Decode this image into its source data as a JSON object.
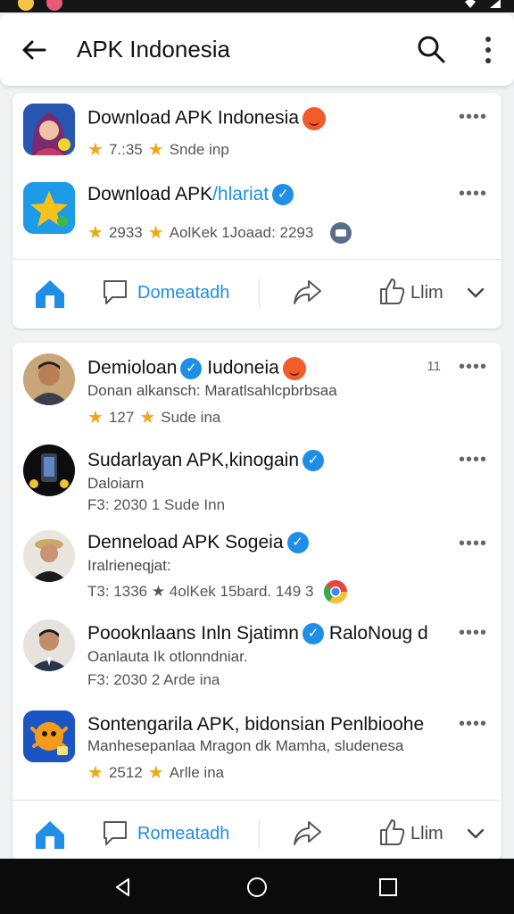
{
  "app_bar": {
    "title": "APK Indonesia"
  },
  "card1": {
    "items": [
      {
        "name": "Download APK Indonesia",
        "meta": "7.:35 ★ Snde inp",
        "rating": "7.:35",
        "meta_tail": "Snde inp",
        "badge": "emoji-red",
        "colors": [
          "#2b57b8",
          "#f0b7a0"
        ]
      },
      {
        "name": "Download APK",
        "name_accent": "/hlariat",
        "rating": "2933",
        "meta_tail": "AolKek  1Joaad: 2293",
        "badge": "verify",
        "colors": [
          "#1e9be6",
          "#f7c11b"
        ]
      }
    ],
    "actions": {
      "label": "Domeatadh",
      "like_label": "Llim"
    }
  },
  "card2": {
    "items": [
      {
        "name": "Demioloan",
        "name_after": "Iudoneia",
        "sub": "Donan alkansch: Maratlsahlcpbrbsaa",
        "rating": "127",
        "meta_tail": "Sude ina",
        "time": "11",
        "badge": "verify-emoji"
      },
      {
        "name": "Sudarlayan APK,kinogain",
        "sub": "Daloiarn",
        "meta": "F3: 2030 1 Sude Inn",
        "badge": "verify"
      },
      {
        "name": "Denneload APK Sogeia",
        "sub": "Iralrieneqjat:",
        "meta": "T3: 1336 ★ 4olKek  15bard. 149 3",
        "badge": "verify"
      },
      {
        "name": "Poooknlaans Inln Sjatimn",
        "name_after": "RaloNoug d",
        "sub": "Oanlauta Ik otlonndniar.",
        "meta": "F3: 2030 2 Arde ina",
        "badge": "verify"
      },
      {
        "name": "Sontengarila APK, bidonsian Penlbioohe",
        "sub": "Manhesepanlaa Mragon dk Mamha, sludenesa",
        "rating": "2512",
        "meta_tail": "Arlle ina"
      }
    ],
    "actions": {
      "label": "Romeatadh",
      "like_label": "Llim"
    }
  },
  "colors": {
    "accent": "#1e8ee6",
    "star": "#f2a516",
    "background": "#f1f2f4"
  },
  "icons": [
    "arrow-left-icon",
    "search-icon",
    "more-vertical-icon",
    "more-horizontal-icon",
    "home-icon",
    "comment-icon",
    "share-icon",
    "like-icon",
    "chevron-down-icon",
    "nav-back-icon",
    "nav-home-icon",
    "nav-recent-icon"
  ]
}
